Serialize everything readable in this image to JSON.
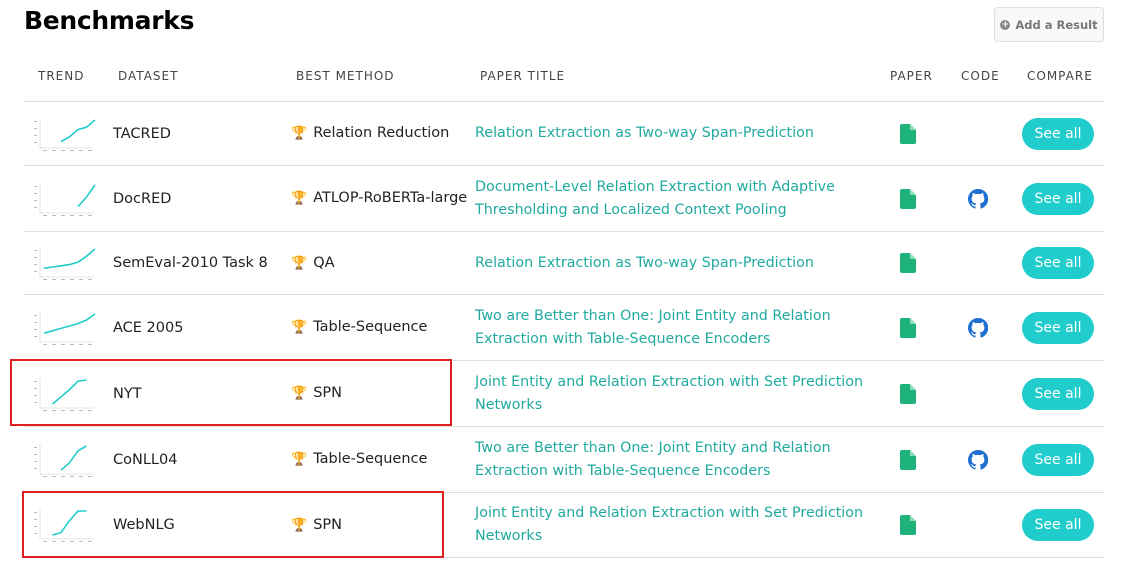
{
  "title": "Benchmarks",
  "add_result": "Add a Result",
  "columns": {
    "trend": "TREND",
    "dataset": "DATASET",
    "method": "BEST METHOD",
    "paper_title": "PAPER TITLE",
    "paper": "PAPER",
    "code": "CODE",
    "compare": "COMPARE"
  },
  "accent": "#21cccc",
  "link_color": "#21aaa0",
  "rows": [
    {
      "dataset": "TACRED",
      "method": "Relation Reduction",
      "paper_title": "Relation Extraction as Two-way Span-Prediction",
      "code": false,
      "compare": "See all",
      "trend": [
        null,
        null,
        0.1,
        0.3,
        0.6,
        0.7,
        1.0
      ],
      "highlighted": false
    },
    {
      "dataset": "DocRED",
      "method": "ATLOP-RoBERTa-large",
      "paper_title": "Document-Level Relation Extraction with Adaptive Thresholding and Localized Context Pooling",
      "code": true,
      "compare": "See all",
      "trend": [
        null,
        null,
        null,
        null,
        0.1,
        0.5,
        1.0
      ],
      "highlighted": false
    },
    {
      "dataset": "SemEval-2010 Task 8",
      "method": "QA",
      "paper_title": "Relation Extraction as Two-way Span-Prediction",
      "code": false,
      "compare": "See all",
      "trend": [
        0.2,
        0.25,
        0.3,
        0.35,
        0.45,
        0.7,
        1.0
      ],
      "highlighted": false
    },
    {
      "dataset": "ACE 2005",
      "method": "Table-Sequence",
      "paper_title": "Two are Better than One: Joint Entity and Relation Extraction with Table-Sequence Encoders",
      "code": true,
      "compare": "See all",
      "trend": [
        0.2,
        0.3,
        0.4,
        0.5,
        0.6,
        0.75,
        1.0
      ],
      "highlighted": false
    },
    {
      "dataset": "NYT",
      "method": "SPN",
      "paper_title": "Joint Entity and Relation Extraction with Set Prediction Networks",
      "code": false,
      "compare": "See all",
      "trend": [
        null,
        0.0,
        0.3,
        0.6,
        0.95,
        1.0,
        null
      ],
      "highlighted": true
    },
    {
      "dataset": "CoNLL04",
      "method": "Table-Sequence",
      "paper_title": "Two are Better than One: Joint Entity and Relation Extraction with Table-Sequence Encoders",
      "code": true,
      "compare": "See all",
      "trend": [
        null,
        null,
        0.0,
        0.3,
        0.8,
        1.0,
        null
      ],
      "highlighted": false
    },
    {
      "dataset": "WebNLG",
      "method": "SPN",
      "paper_title": "Joint Entity and Relation Extraction with Set Prediction Networks",
      "code": false,
      "compare": "See all",
      "trend": [
        null,
        0.0,
        0.1,
        0.6,
        1.0,
        1.0,
        null
      ],
      "highlighted": true
    }
  ]
}
